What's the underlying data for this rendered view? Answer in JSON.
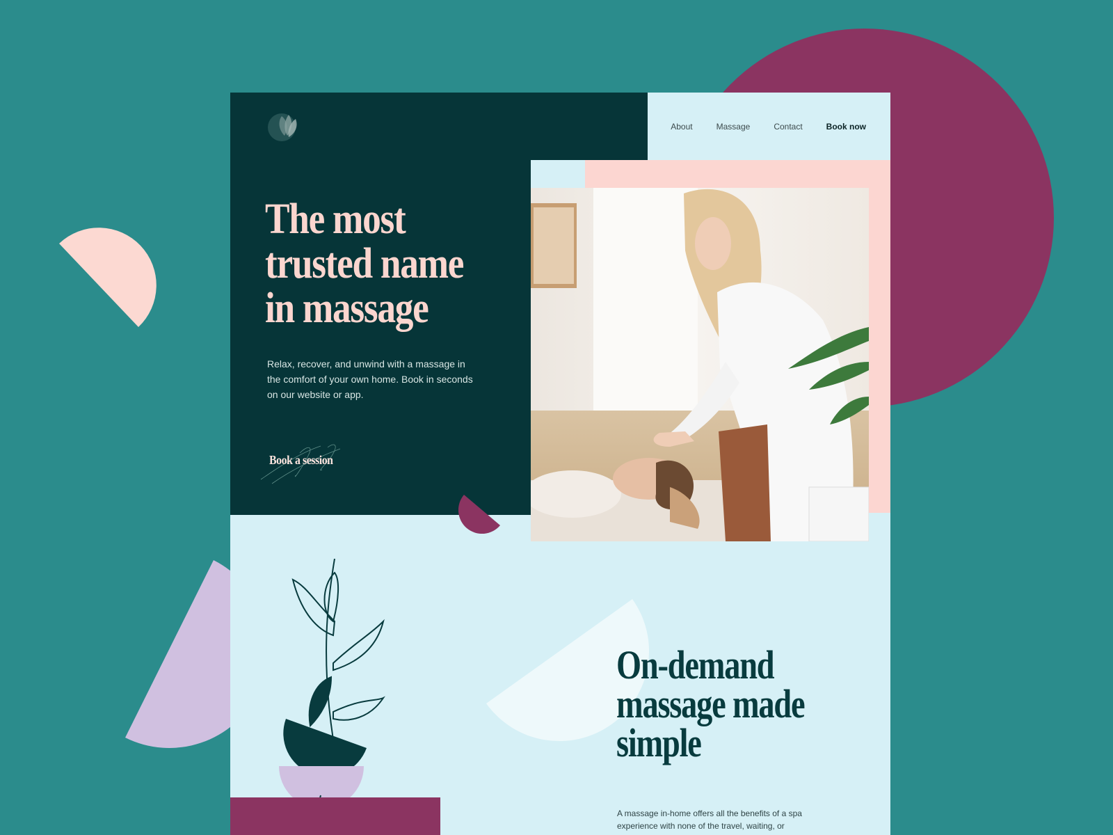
{
  "colors": {
    "background": "#2b8c8c",
    "dark_green": "#063538",
    "light_blue": "#d6f0f6",
    "pink": "#fcd6d1",
    "plum": "#8b3461",
    "lavender": "#d0c0e0"
  },
  "logo": {
    "icon": "lotus-icon"
  },
  "nav": {
    "items": [
      "About",
      "Massage",
      "Contact"
    ],
    "book_label": "Book now"
  },
  "hero": {
    "title": "The most trusted name in massage",
    "text": "Relax, recover, and unwind with a massage in the comfort of your own home. Book in seconds on our website or app.",
    "cta_label": "Book a session",
    "image": "Therapist giving a facial massage to a woman lying on a massage table"
  },
  "section2": {
    "title": "On-demand massage made simple",
    "text": "A massage in-home offers all the benefits of a spa experience with none of the travel, waiting, or"
  }
}
